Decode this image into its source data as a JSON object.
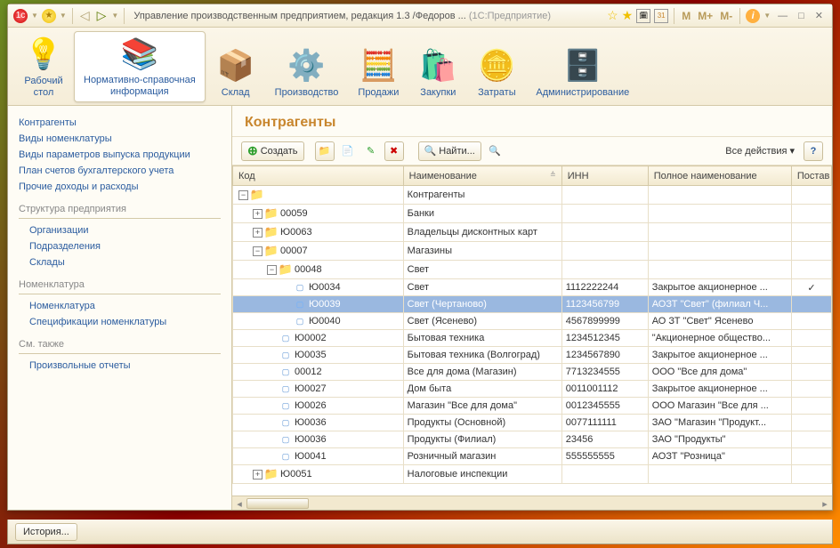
{
  "titlebar": {
    "title": "Управление производственным предприятием, редакция 1.3 /Федоров ...",
    "app": "(1С:Предприятие)",
    "m1": "M",
    "m2": "M+",
    "m3": "M-"
  },
  "ribbon": [
    {
      "label": "Рабочий\nстол",
      "icon": "💡",
      "active": false
    },
    {
      "label": "Нормативно-справочная\nинформация",
      "icon": "📚",
      "active": true
    },
    {
      "label": "Склад",
      "icon": "📦",
      "active": false
    },
    {
      "label": "Производство",
      "icon": "⚙️",
      "active": false
    },
    {
      "label": "Продажи",
      "icon": "🧮",
      "active": false
    },
    {
      "label": "Закупки",
      "icon": "🛍️",
      "active": false
    },
    {
      "label": "Затраты",
      "icon": "🪙",
      "active": false
    },
    {
      "label": "Администрирование",
      "icon": "🗄️",
      "active": false
    }
  ],
  "sidebar": {
    "top": [
      "Контрагенты",
      "Виды номенклатуры",
      "Виды параметров выпуска продукции",
      "План счетов бухгалтерского учета",
      "Прочие доходы и расходы"
    ],
    "groups": [
      {
        "title": "Структура предприятия",
        "items": [
          "Организации",
          "Подразделения",
          "Склады"
        ]
      },
      {
        "title": "Номенклатура",
        "items": [
          "Номенклатура",
          "Спецификации номенклатуры"
        ]
      },
      {
        "title": "См. также",
        "items": [
          "Произвольные отчеты"
        ]
      }
    ]
  },
  "main": {
    "title": "Контрагенты",
    "toolbar": {
      "create": "Создать",
      "find": "Найти...",
      "all_actions": "Все действия"
    },
    "columns": {
      "code": "Код",
      "name": "Наименование",
      "inn": "ИНН",
      "full": "Полное наименование",
      "sup": "Постав"
    },
    "rows": [
      {
        "level": 0,
        "exp": "-",
        "ico": "folder",
        "code": "",
        "name": "Контрагенты",
        "inn": "",
        "full": "",
        "sup": ""
      },
      {
        "level": 1,
        "exp": "+",
        "ico": "folder",
        "code": "00059",
        "name": "Банки",
        "inn": "",
        "full": "",
        "sup": ""
      },
      {
        "level": 1,
        "exp": "+",
        "ico": "folder",
        "code": "Ю0063",
        "name": "Владельцы дисконтных карт",
        "inn": "",
        "full": "",
        "sup": ""
      },
      {
        "level": 1,
        "exp": "-",
        "ico": "folder",
        "code": "00007",
        "name": "Магазины",
        "inn": "",
        "full": "",
        "sup": ""
      },
      {
        "level": 2,
        "exp": "-",
        "ico": "folder",
        "code": "00048",
        "name": "Свет",
        "inn": "",
        "full": "",
        "sup": ""
      },
      {
        "level": 3,
        "exp": " ",
        "ico": "item",
        "code": "Ю0034",
        "name": "Свет",
        "inn": "1112222244",
        "full": "Закрытое акционерное ...",
        "sup": "✓"
      },
      {
        "level": 3,
        "exp": " ",
        "ico": "item",
        "code": "Ю0039",
        "name": "Свет (Чертаново)",
        "inn": "1123456799",
        "full": "АОЗТ \"Свет\" (филиал Ч...",
        "sup": "",
        "selected": true
      },
      {
        "level": 3,
        "exp": " ",
        "ico": "item",
        "code": "Ю0040",
        "name": "Свет (Ясенево)",
        "inn": "4567899999",
        "full": "АО ЗТ \"Свет\" Ясенево",
        "sup": ""
      },
      {
        "level": 2,
        "exp": " ",
        "ico": "item",
        "code": "Ю0002",
        "name": "Бытовая техника",
        "inn": "1234512345",
        "full": "\"Акционерное общество...",
        "sup": ""
      },
      {
        "level": 2,
        "exp": " ",
        "ico": "item",
        "code": "Ю0035",
        "name": "Бытовая техника (Волгоград)",
        "inn": "1234567890",
        "full": "Закрытое акционерное ...",
        "sup": ""
      },
      {
        "level": 2,
        "exp": " ",
        "ico": "item",
        "code": "00012",
        "name": "Все для дома (Магазин)",
        "inn": "7713234555",
        "full": "ООО \"Все для дома\"",
        "sup": ""
      },
      {
        "level": 2,
        "exp": " ",
        "ico": "item",
        "code": "Ю0027",
        "name": "Дом быта",
        "inn": "0011001112",
        "full": "Закрытое акционерное ...",
        "sup": ""
      },
      {
        "level": 2,
        "exp": " ",
        "ico": "item",
        "code": "Ю0026",
        "name": "Магазин \"Все для дома\"",
        "inn": "0012345555",
        "full": "ООО Магазин \"Все для ...",
        "sup": ""
      },
      {
        "level": 2,
        "exp": " ",
        "ico": "item",
        "code": "Ю0036",
        "name": "Продукты (Основной)",
        "inn": "0077111111",
        "full": "ЗАО \"Магазин \"Продукт...",
        "sup": ""
      },
      {
        "level": 2,
        "exp": " ",
        "ico": "item",
        "code": "Ю0036",
        "name": "Продукты (Филиал)",
        "inn": "23456",
        "full": "ЗАО \"Продукты\"",
        "sup": ""
      },
      {
        "level": 2,
        "exp": " ",
        "ico": "item",
        "code": "Ю0041",
        "name": "Розничный магазин",
        "inn": "555555555",
        "full": "АОЗТ \"Розница\"",
        "sup": ""
      },
      {
        "level": 1,
        "exp": "+",
        "ico": "folder",
        "code": "Ю0051",
        "name": "Налоговые инспекции",
        "inn": "",
        "full": "",
        "sup": ""
      }
    ]
  },
  "statusbar": {
    "history": "История..."
  }
}
